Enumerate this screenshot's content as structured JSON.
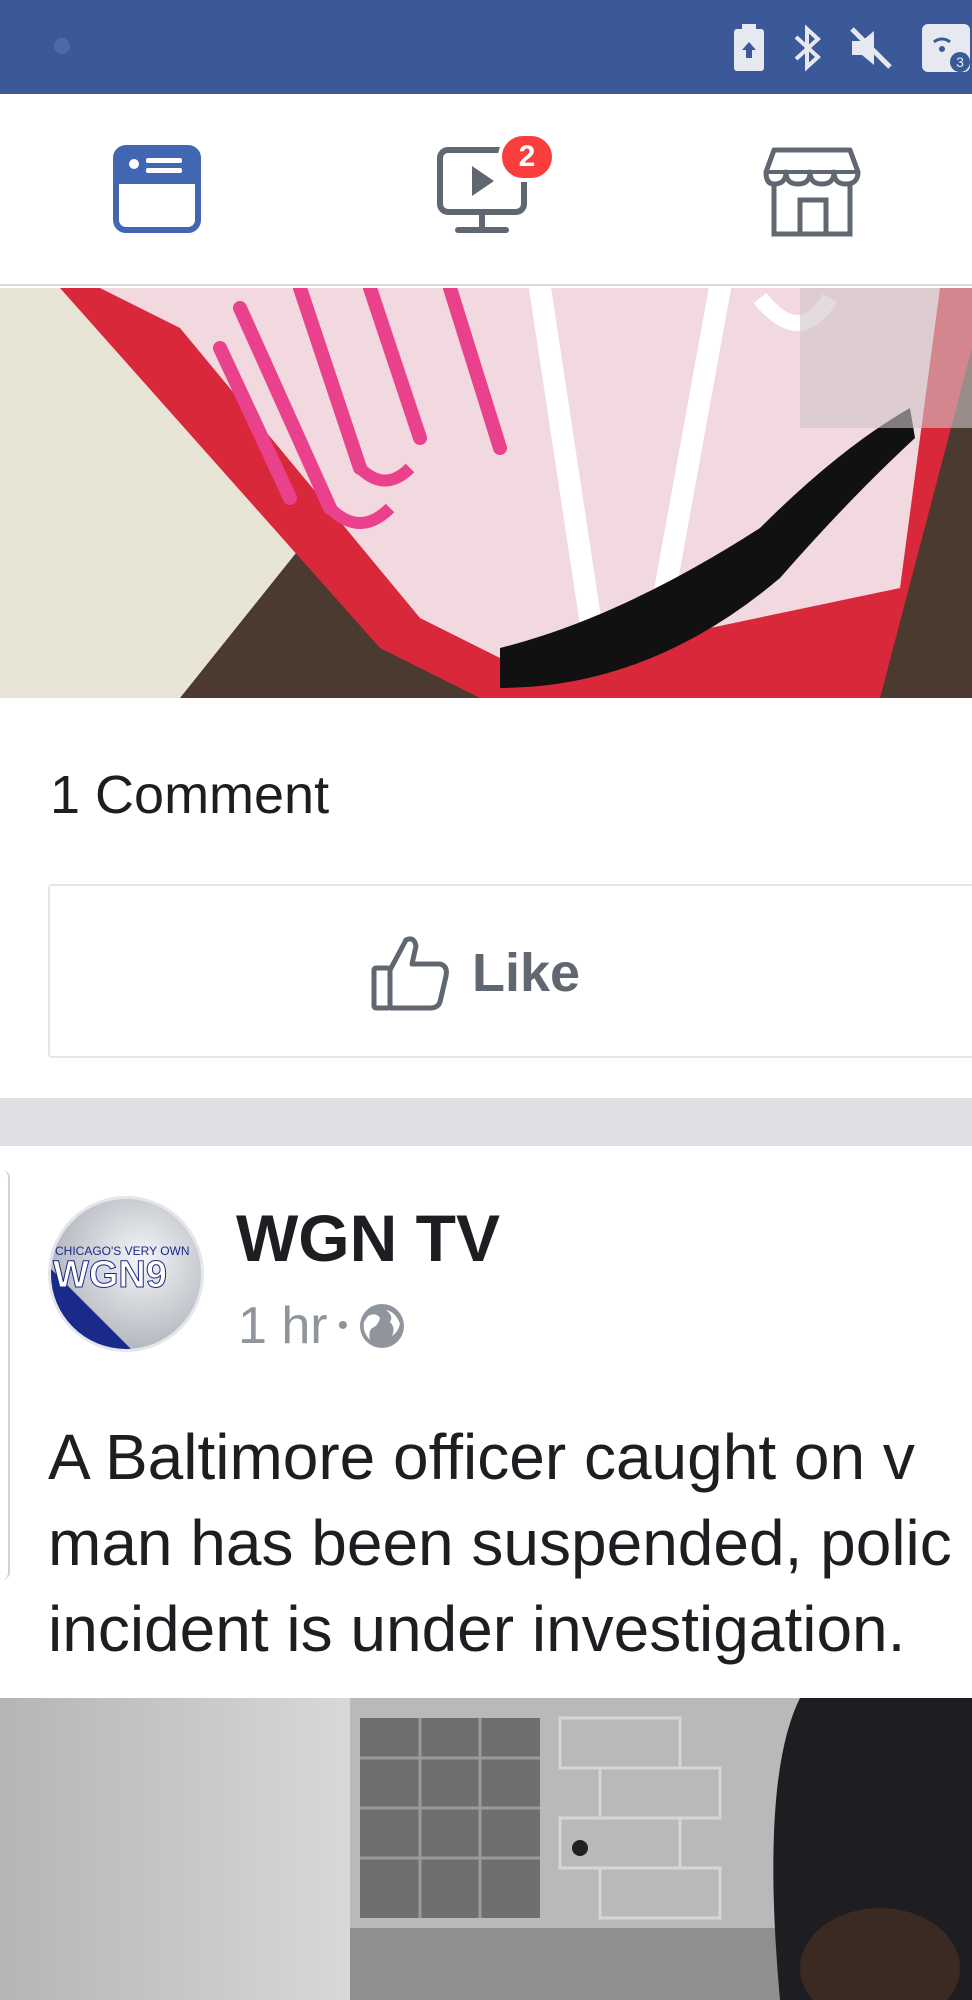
{
  "status_bar": {
    "icons": [
      "battery-saver-icon",
      "bluetooth-icon",
      "muted-icon",
      "hotspot-icon"
    ],
    "hotspot_count": "3"
  },
  "top_nav": {
    "items": [
      {
        "name": "news-feed",
        "icon": "news-feed-icon",
        "active": true
      },
      {
        "name": "watch",
        "icon": "watch-icon",
        "badge": "2"
      },
      {
        "name": "marketplace",
        "icon": "marketplace-icon"
      }
    ]
  },
  "post1": {
    "comment_count": "1 Comment",
    "like_label": "Like"
  },
  "post2": {
    "page_name": "WGN TV",
    "avatar_logo_tagline": "CHICAGO'S VERY OWN",
    "avatar_logo_text": "WGN9",
    "time": "1 hr",
    "separator": "•",
    "privacy_icon": "globe-icon",
    "text_lines": [
      "A Baltimore officer caught on v",
      "man has been suspended, polic",
      "incident is under investigation."
    ]
  },
  "colors": {
    "status_bar": "#3b5998",
    "active_icon": "#4267b2",
    "inactive_icon": "#606770",
    "badge": "#fa3e3e",
    "separator": "#dddfe2"
  }
}
